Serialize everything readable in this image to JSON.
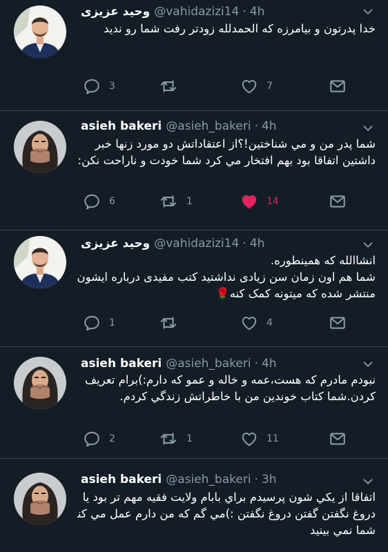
{
  "tweets": [
    {
      "name": "وحید عزیزی",
      "handle": "@vahidazizi14",
      "time": "4h",
      "lines": [
        "خدا پدرتون و بیامرزه که الحمدلله زودتر رفت شما رو ندید"
      ],
      "replies": "3",
      "retweets": "",
      "likes": "7",
      "liked": false
    },
    {
      "name": "asieh bakeri",
      "handle": "@asieh_bakeri",
      "time": "4h",
      "lines": [
        "شما پدر من و مي شناختين!؟از اعتقاداتش دو مورد زنها خبر",
        "داشتين اتفاقا بود بهم افتخار مي كرد شما خودت و ناراحت نكن:)"
      ],
      "replies": "6",
      "retweets": "1",
      "likes": "14",
      "liked": true
    },
    {
      "name": "وحید عزیزی",
      "handle": "@vahidazizi14",
      "time": "4h",
      "lines": [
        "انشاالله که همینطوره.",
        "شما هم اون زمان سن زیادی نداشتید کتب مفیدی درباره ایشون",
        "منتشر شده که میتونه کمک کنه🌹"
      ],
      "replies": "1",
      "retweets": "",
      "likes": "4",
      "liked": false
    },
    {
      "name": "asieh bakeri",
      "handle": "@asieh_bakeri",
      "time": "4h",
      "lines": [
        "نبودم مادرم که هست،عمه و خاله و عمو كه دارم:)برام تعريف",
        "كردن.شما كتاب خوندين من با خاطراتش زندگي كردم."
      ],
      "replies": "2",
      "retweets": "1",
      "likes": "11",
      "liked": false
    },
    {
      "name": "asieh bakeri",
      "handle": "@asieh_bakeri",
      "time": "3h",
      "lines": [
        "اتفاقا از يكي شون پرسيدم براي بابام ولايت فقيه مهم تر بود يا",
        "دروغ نگفتن گفتن دروغ نگفتن :)مي گم كه من دارم عمل مي كنم",
        "شما نمي بينيد"
      ],
      "replies": "",
      "retweets": "",
      "likes": "",
      "liked": false
    }
  ],
  "colors": {
    "background": "#141d26",
    "divider": "#38444d",
    "muted": "#8899a6",
    "like": "#e0245e"
  },
  "icons": [
    "avatar-man",
    "avatar-woman",
    "reply-icon",
    "retweet-icon",
    "heart-icon",
    "mail-icon",
    "chevron-down-icon"
  ]
}
